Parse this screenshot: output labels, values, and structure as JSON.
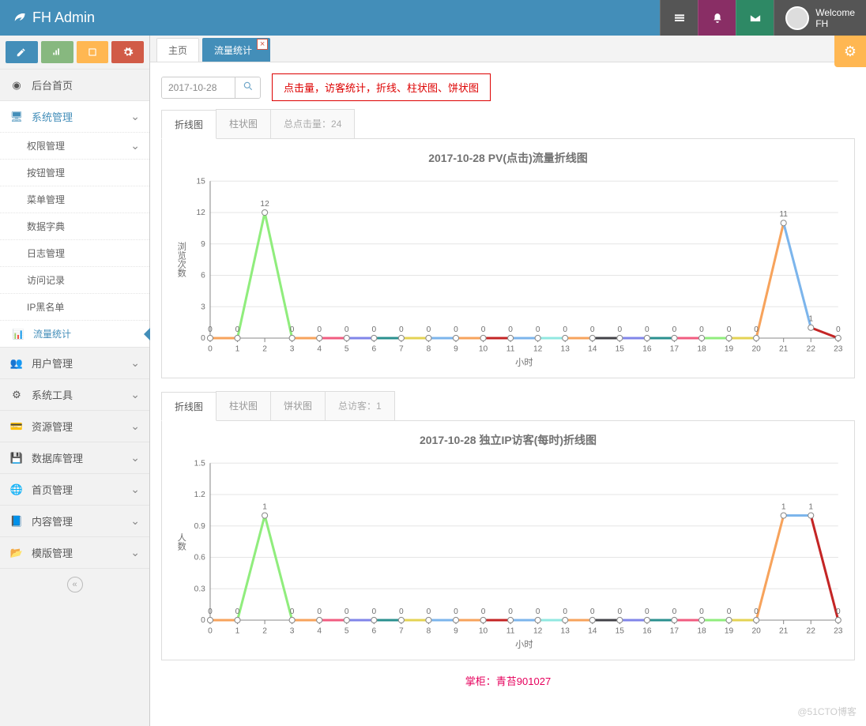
{
  "brand": "FH Admin",
  "user": {
    "welcome": "Welcome",
    "name": "FH"
  },
  "sb_buttons": [
    "pencil",
    "bars",
    "book",
    "cogs"
  ],
  "menu": {
    "home": "后台首页",
    "system": "系统管理",
    "system_sub": [
      "权限管理",
      "按钮管理",
      "菜单管理",
      "数据字典",
      "日志管理",
      "访问记录",
      "IP黑名单",
      "流量统计"
    ],
    "users": "用户管理",
    "tools": "系统工具",
    "res": "资源管理",
    "db": "数据库管理",
    "homep": "首页管理",
    "content": "内容管理",
    "tpl": "模版管理"
  },
  "tabs": {
    "home": "主页",
    "stats": "流量统计"
  },
  "filter": {
    "date": "2017-10-28"
  },
  "note": "点击量，访客统计，折线、柱状图、饼状图",
  "chart1": {
    "tabs": [
      "折线图",
      "柱状图"
    ],
    "total": "总点击量：24",
    "title": "2017-10-28  PV(点击)流量折线图",
    "xlabel": "小时",
    "ylabel": "浏览次数"
  },
  "chart2": {
    "tabs": [
      "折线图",
      "柱状图",
      "饼状图"
    ],
    "total": "总访客：1",
    "title": "2017-10-28  独立IP访客(每时)折线图",
    "xlabel": "小时",
    "ylabel": "人数"
  },
  "footer": "掌柜：青苔901027",
  "watermark": "@51CTO博客",
  "chart_data": [
    {
      "type": "line",
      "title": "2017-10-28  PV(点击)流量折线图",
      "xlabel": "小时",
      "ylabel": "浏览次数",
      "ylim": [
        0,
        15
      ],
      "x": [
        0,
        1,
        2,
        3,
        4,
        5,
        6,
        7,
        8,
        9,
        10,
        11,
        12,
        13,
        14,
        15,
        16,
        17,
        18,
        19,
        20,
        21,
        22,
        23
      ],
      "values": [
        0,
        0,
        12,
        0,
        0,
        0,
        0,
        0,
        0,
        0,
        0,
        0,
        0,
        0,
        0,
        0,
        0,
        0,
        0,
        0,
        0,
        11,
        1,
        0
      ]
    },
    {
      "type": "line",
      "title": "2017-10-28  独立IP访客(每时)折线图",
      "xlabel": "小时",
      "ylabel": "人数",
      "ylim": [
        0,
        1.5
      ],
      "x": [
        0,
        1,
        2,
        3,
        4,
        5,
        6,
        7,
        8,
        9,
        10,
        11,
        12,
        13,
        14,
        15,
        16,
        17,
        18,
        19,
        20,
        21,
        22,
        23
      ],
      "values": [
        0,
        0,
        1,
        0,
        0,
        0,
        0,
        0,
        0,
        0,
        0,
        0,
        0,
        0,
        0,
        0,
        0,
        0,
        0,
        0,
        0,
        1,
        1,
        0
      ]
    }
  ],
  "seg_colors": [
    "#f7a35c",
    "#90ed7d",
    "#90ed7d",
    "#f7a35c",
    "#f15c80",
    "#8085e9",
    "#2b908f",
    "#e4d354",
    "#7cb5ec",
    "#f7a35c",
    "#c42525",
    "#7cb5ec",
    "#91e8e1",
    "#f7a35c",
    "#434348",
    "#8085e9",
    "#2b908f",
    "#f15c80",
    "#90ed7d",
    "#e4d354",
    "#f7a35c",
    "#7cb5ec",
    "#c42525"
  ]
}
